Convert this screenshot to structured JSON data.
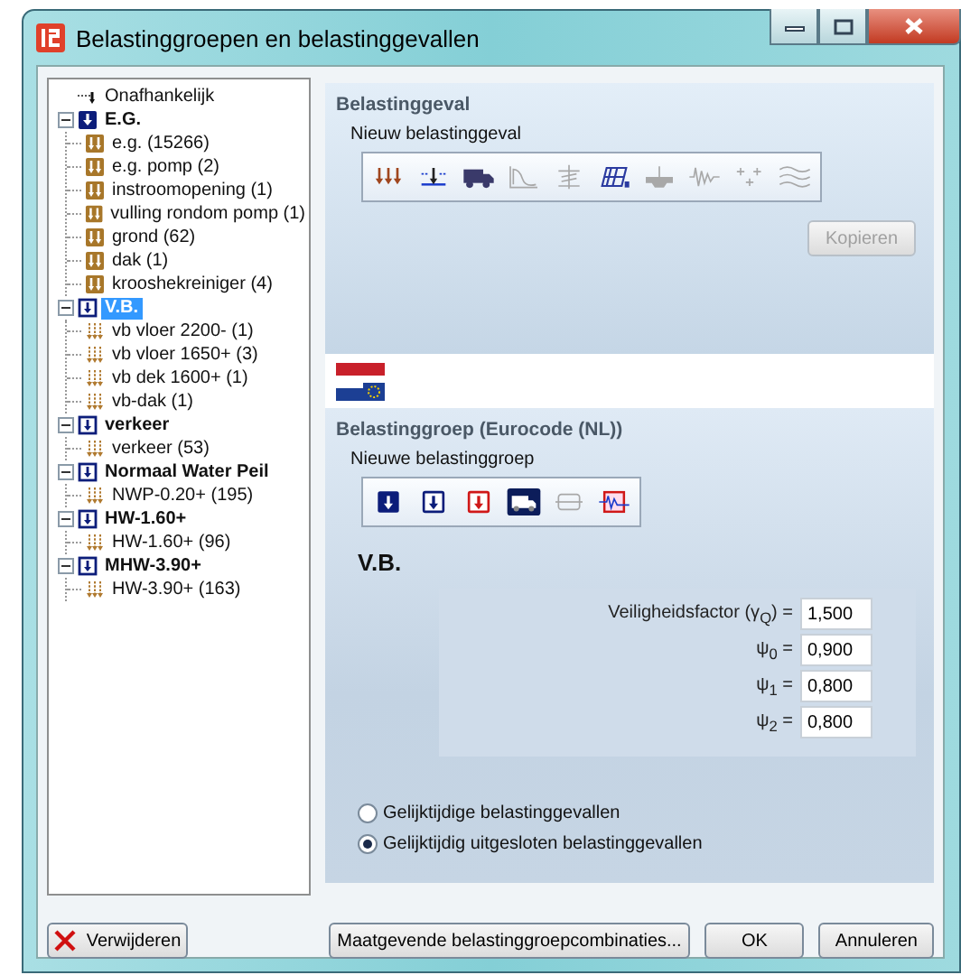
{
  "window": {
    "title": "Belastinggroepen en belastinggevallen"
  },
  "tree": [
    {
      "label": "Onafhankelijk",
      "kind": "independent",
      "selected": false
    },
    {
      "label": "E.G.",
      "kind": "permanent",
      "expanded": true,
      "selected": false,
      "children": [
        {
          "label": "e.g. (15266)",
          "kind": "permanent",
          "selected": false
        },
        {
          "label": "e.g. pomp (2)",
          "kind": "permanent",
          "selected": false
        },
        {
          "label": "instroomopening (1)",
          "kind": "permanent",
          "selected": false
        },
        {
          "label": "vulling rondom pomp (1)",
          "kind": "permanent",
          "selected": false
        },
        {
          "label": "grond (62)",
          "kind": "permanent",
          "selected": false
        },
        {
          "label": "dak (1)",
          "kind": "permanent",
          "selected": false
        },
        {
          "label": "krooshekreiniger (4)",
          "kind": "permanent",
          "selected": false
        }
      ]
    },
    {
      "label": "V.B.",
      "kind": "variable",
      "expanded": true,
      "selected": true,
      "children": [
        {
          "label": "vb vloer 2200- (1)",
          "kind": "variable",
          "selected": false
        },
        {
          "label": "vb vloer 1650+ (3)",
          "kind": "variable",
          "selected": false
        },
        {
          "label": "vb dek 1600+ (1)",
          "kind": "variable",
          "selected": false
        },
        {
          "label": "vb-dak (1)",
          "kind": "variable",
          "selected": false
        }
      ]
    },
    {
      "label": "verkeer",
      "kind": "variable",
      "expanded": true,
      "selected": false,
      "children": [
        {
          "label": "verkeer (53)",
          "kind": "variable",
          "selected": false
        }
      ]
    },
    {
      "label": "Normaal Water Peil",
      "kind": "variable",
      "expanded": true,
      "selected": false,
      "children": [
        {
          "label": "NWP-0.20+ (195)",
          "kind": "variable",
          "selected": false
        }
      ]
    },
    {
      "label": "HW-1.60+",
      "kind": "variable",
      "expanded": true,
      "selected": false,
      "children": [
        {
          "label": "HW-1.60+ (96)",
          "kind": "variable",
          "selected": false
        }
      ]
    },
    {
      "label": "MHW-3.90+",
      "kind": "variable",
      "expanded": true,
      "selected": false,
      "children": [
        {
          "label": "HW-3.90+ (163)",
          "kind": "variable",
          "selected": false
        }
      ]
    }
  ],
  "load_case": {
    "title": "Belastinggeval",
    "subtitle": "Nieuw belastinggeval",
    "tools": [
      {
        "kind": "distributed",
        "disabled": false
      },
      {
        "kind": "point",
        "disabled": false
      },
      {
        "kind": "truck",
        "disabled": false
      },
      {
        "kind": "curve",
        "disabled": true
      },
      {
        "kind": "spring",
        "disabled": true
      },
      {
        "kind": "frame",
        "disabled": false
      },
      {
        "kind": "crane",
        "disabled": true
      },
      {
        "kind": "seismic",
        "disabled": true
      },
      {
        "kind": "scatter",
        "disabled": true
      },
      {
        "kind": "wind",
        "disabled": true
      }
    ],
    "copy_button": {
      "label": "Kopieren",
      "disabled": true
    }
  },
  "load_group": {
    "title": "Belastinggroep (Eurocode (NL))",
    "subtitle": "Nieuwe belastinggroep",
    "tools": [
      {
        "kind": "permanent",
        "disabled": false
      },
      {
        "kind": "variable",
        "disabled": false
      },
      {
        "kind": "accidental",
        "disabled": false
      },
      {
        "kind": "traffic",
        "disabled": false
      },
      {
        "kind": "displacement",
        "disabled": true
      },
      {
        "kind": "earthquake",
        "disabled": false
      }
    ],
    "name": "V.B.",
    "factors": [
      {
        "label": "Veiligheidsfactor (γ$_{Q}$) =",
        "value": "1,500"
      },
      {
        "label": "ψ$_{0}$ =",
        "value": "0,900"
      },
      {
        "label": "ψ$_{1}$ =",
        "value": "0,800"
      },
      {
        "label": "ψ$_{2}$ =",
        "value": "0,800"
      }
    ],
    "options": [
      {
        "label": "Gelijktijdige belastinggevallen",
        "selected": false
      },
      {
        "label": "Gelijktijdig uitgesloten belastinggevallen",
        "selected": true
      }
    ]
  },
  "buttons": [
    {
      "label": "Verwijderen",
      "kind": "delete"
    },
    {
      "label": "Maatgevende belastinggroepcombinaties...",
      "kind": "plain"
    },
    {
      "label": "OK",
      "kind": "plain"
    },
    {
      "label": "Annuleren",
      "kind": "plain"
    }
  ]
}
